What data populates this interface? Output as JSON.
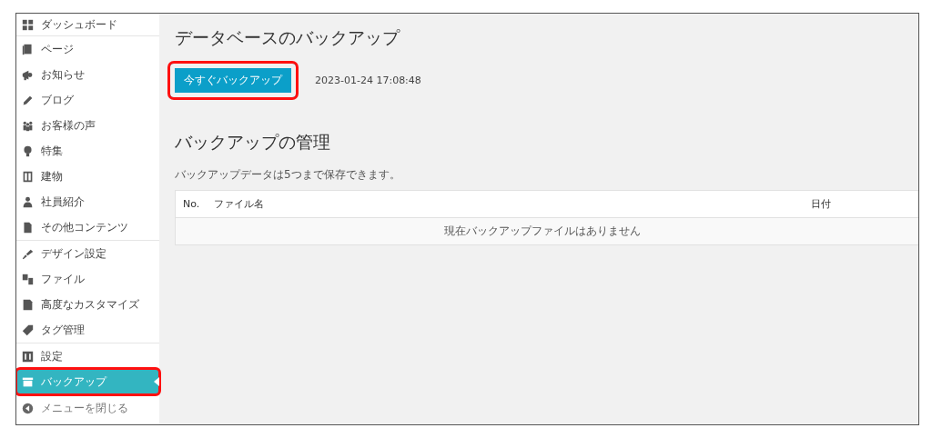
{
  "sidebar": {
    "groups": [
      {
        "items": [
          {
            "label": "ダッシュボード",
            "selected": false,
            "highlighted": false
          }
        ]
      },
      {
        "items": [
          {
            "label": "ページ",
            "selected": false,
            "highlighted": false
          },
          {
            "label": "お知らせ",
            "selected": false,
            "highlighted": false
          },
          {
            "label": "ブログ",
            "selected": false,
            "highlighted": false
          },
          {
            "label": "お客様の声",
            "selected": false,
            "highlighted": false
          },
          {
            "label": "特集",
            "selected": false,
            "highlighted": false
          },
          {
            "label": "建物",
            "selected": false,
            "highlighted": false
          },
          {
            "label": "社員紹介",
            "selected": false,
            "highlighted": false
          },
          {
            "label": "その他コンテンツ",
            "selected": false,
            "highlighted": false
          }
        ]
      },
      {
        "items": [
          {
            "label": "デザイン設定",
            "selected": false,
            "highlighted": false
          },
          {
            "label": "ファイル",
            "selected": false,
            "highlighted": false
          },
          {
            "label": "高度なカスタマイズ",
            "selected": false,
            "highlighted": false
          },
          {
            "label": "タグ管理",
            "selected": false,
            "highlighted": false
          }
        ]
      },
      {
        "items": [
          {
            "label": "設定",
            "selected": false,
            "highlighted": false
          },
          {
            "label": "バックアップ",
            "selected": true,
            "highlighted": true
          }
        ]
      }
    ],
    "collapse_label": "メニューを閉じる"
  },
  "main": {
    "title": "データベースのバックアップ",
    "backup_button": {
      "label": "今すぐバックアップ",
      "highlighted": true
    },
    "last_backup": "2023-01-24 17:08:48",
    "section_title": "バックアップの管理",
    "note": "バックアップデータは5つまで保存できます。",
    "table": {
      "columns": [
        "No.",
        "ファイル名",
        "日付"
      ],
      "empty_message": "現在バックアップファイルはありません"
    }
  }
}
